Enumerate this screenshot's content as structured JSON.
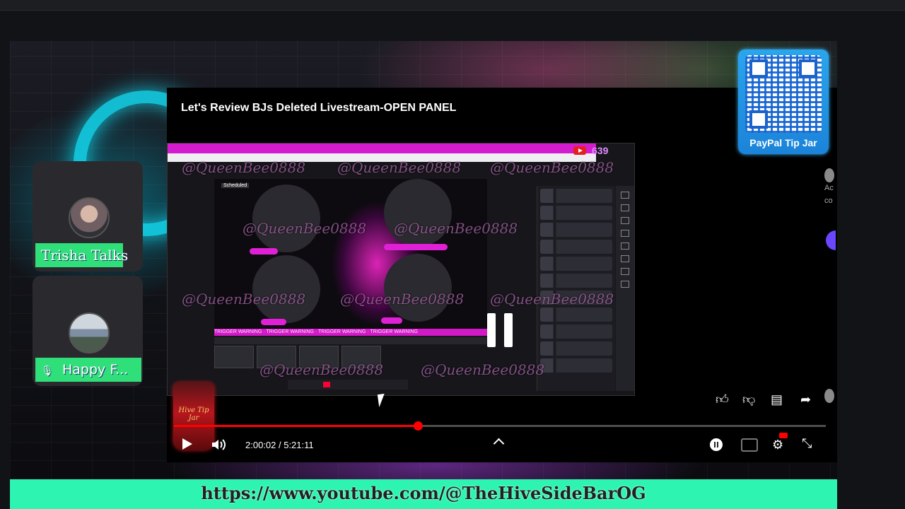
{
  "video": {
    "title": "Let's Review BJs Deleted Livestream-OPEN PANEL",
    "time_current": "2:00:02",
    "time_total": "5:21:11",
    "time_display": "2:00:02 / 5:21:11",
    "progress_fraction": 0.374
  },
  "watermark": "@QueenBee0888",
  "embedded_screen": {
    "scheduled_badge": "Scheduled",
    "warning_text": "TRIGGER WARNING · TRIGGER WARNING · TRIGGER WARNING · TRIGGER WARNING",
    "count_badge": "639"
  },
  "qr_card": {
    "label": "PayPal Tip Jar"
  },
  "guests": [
    {
      "name": "Trisha Talks",
      "muted": false
    },
    {
      "name": "Happy F...",
      "muted": true
    }
  ],
  "tip_jar": {
    "label": "Hive Tip Jar"
  },
  "banner": {
    "url_text": "https://www.youtube.com/@TheHiveSideBarOG"
  },
  "edge": {
    "text_1": "Ac",
    "text_2": "co"
  },
  "icons": {
    "play": "play-icon",
    "volume": "volume-icon",
    "pause": "pause-icon",
    "like": "thumbs-up-icon",
    "dislike": "thumbs-down-icon",
    "comments": "comment-icon",
    "share": "share-icon",
    "settings": "gear-icon",
    "captions": "cc-icon",
    "miniplayer": "exit-fullscreen-icon"
  },
  "colors": {
    "progress": "#ff0000",
    "banner": "#2df4b0",
    "name_tag": "#2fe07a",
    "qr_card": "#1b83d9"
  }
}
